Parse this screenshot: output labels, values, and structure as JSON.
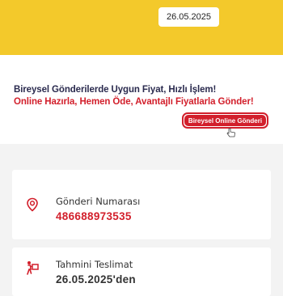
{
  "header": {
    "date": "26.05.2025"
  },
  "promo": {
    "title": "Bireysel Gönderilerde Uygun Fiyat, Hızlı İşlem!",
    "subtitle": "Online Hazırla, Hemen Öde, Avantajlı Fiyatlarla Gönder!",
    "button_label": "Bireysel Online Gönderi",
    "accent_color": "#d21f2b",
    "brand_color": "#f3c92b"
  },
  "shipment": {
    "number_label": "Gönderi Numarası",
    "number_value": "486688973535",
    "number_icon": "location-pin-icon",
    "delivery_label": "Tahmini Teslimat",
    "delivery_value": "26.05.2025'den",
    "delivery_icon": "courier-icon"
  }
}
